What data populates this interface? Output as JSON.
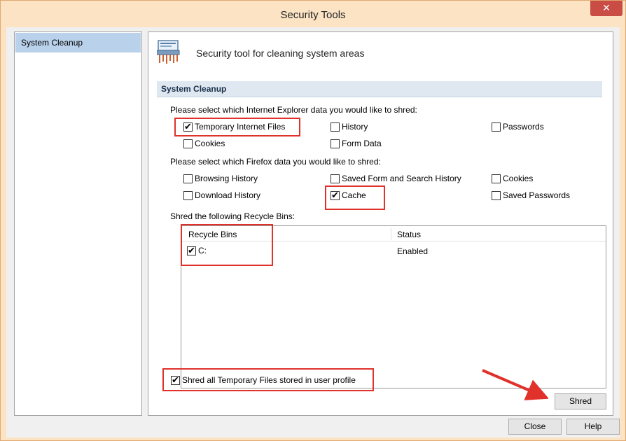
{
  "window": {
    "title": "Security Tools",
    "close_glyph": "✕"
  },
  "nav": {
    "items": [
      {
        "label": "System Cleanup",
        "selected": true
      }
    ]
  },
  "header": {
    "icon": "shredder-icon",
    "text": "Security tool for cleaning system areas"
  },
  "section": {
    "title": "System Cleanup"
  },
  "ie": {
    "prompt": "Please select which Internet Explorer data you would like to shred:",
    "options": [
      {
        "label": "Temporary Internet Files",
        "checked": true
      },
      {
        "label": "History",
        "checked": false
      },
      {
        "label": "Passwords",
        "checked": false
      },
      {
        "label": "Cookies",
        "checked": false
      },
      {
        "label": "Form Data",
        "checked": false
      }
    ]
  },
  "firefox": {
    "prompt": "Please select which Firefox data you would like to shred:",
    "options": [
      {
        "label": "Browsing History",
        "checked": false
      },
      {
        "label": "Saved Form and Search History",
        "checked": false
      },
      {
        "label": "Cookies",
        "checked": false
      },
      {
        "label": "Download History",
        "checked": false
      },
      {
        "label": "Cache",
        "checked": true
      },
      {
        "label": "Saved Passwords",
        "checked": false
      }
    ]
  },
  "recycle": {
    "prompt": "Shred the following Recycle Bins:",
    "columns": [
      "Recycle Bins",
      "Status"
    ],
    "rows": [
      {
        "name": "C:",
        "status": "Enabled",
        "checked": true
      }
    ]
  },
  "temp_profile": {
    "label": "Shred all Temporary Files stored in user profile",
    "checked": true
  },
  "buttons": {
    "shred": "Shred",
    "close": "Close",
    "help": "Help"
  },
  "check_glyph": "✔",
  "colors": {
    "highlight": "#e0312b",
    "title_bar": "#fbe3c4",
    "selected_nav": "#b9d1ea"
  }
}
